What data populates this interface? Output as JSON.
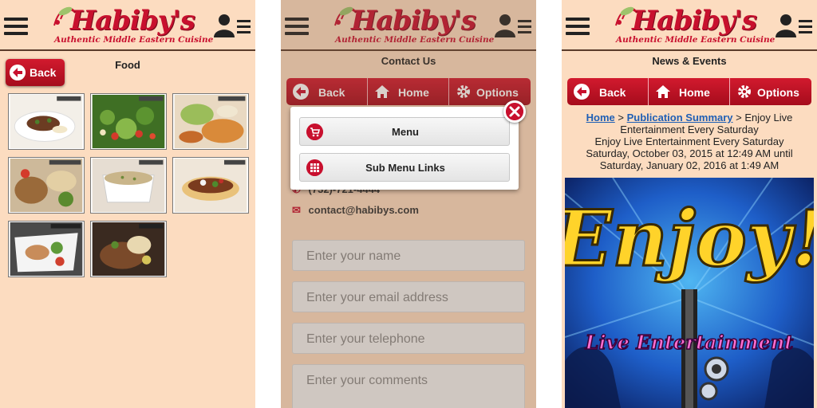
{
  "brand": {
    "name": "Habiby's",
    "tagline": "Authentic Middle Eastern Cuisine",
    "accent": "#c8102e",
    "background": "#fcdcc0"
  },
  "screens": [
    {
      "title": "Food",
      "back_label": "Back",
      "thumbnail_count": 8
    },
    {
      "title": "Contact Us",
      "nav": {
        "back": "Back",
        "home": "Home",
        "options": "Options"
      },
      "phone": "(732)-721-4444",
      "email": "contact@habibys.com",
      "form": {
        "name_placeholder": "Enter your name",
        "email_placeholder": "Enter your email address",
        "phone_placeholder": "Enter your telephone",
        "comments_placeholder": "Enter your comments"
      },
      "popup": {
        "menu_label": "Menu",
        "submenu_label": "Sub Menu Links"
      }
    },
    {
      "title": "News & Events",
      "nav": {
        "back": "Back",
        "home": "Home",
        "options": "Options"
      },
      "breadcrumb": {
        "home": "Home",
        "sep": ">",
        "summary": "Publication Summary",
        "current": "Enjoy Live Entertainment Every Saturday"
      },
      "article_title": "Enjoy Live Entertainment Every Saturday",
      "date_range": "Saturday, October 03, 2015 at 12:49 AM until Saturday, January 02, 2016 at 1:49 AM",
      "poster": {
        "headline": "Enjoy!",
        "subline": "Live Entertainment"
      }
    }
  ]
}
